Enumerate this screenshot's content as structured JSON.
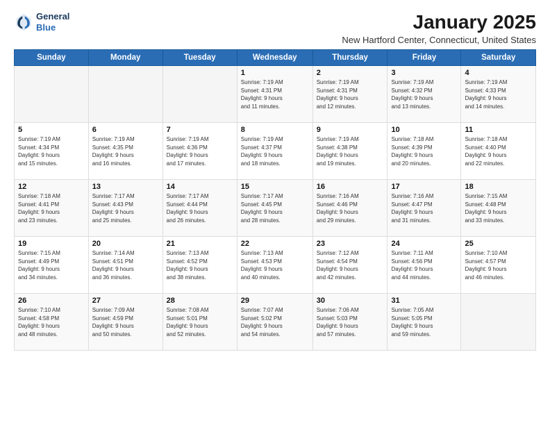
{
  "header": {
    "logo_line1": "General",
    "logo_line2": "Blue",
    "month": "January 2025",
    "location": "New Hartford Center, Connecticut, United States"
  },
  "weekdays": [
    "Sunday",
    "Monday",
    "Tuesday",
    "Wednesday",
    "Thursday",
    "Friday",
    "Saturday"
  ],
  "weeks": [
    [
      {
        "day": "",
        "info": ""
      },
      {
        "day": "",
        "info": ""
      },
      {
        "day": "",
        "info": ""
      },
      {
        "day": "1",
        "info": "Sunrise: 7:19 AM\nSunset: 4:31 PM\nDaylight: 9 hours\nand 11 minutes."
      },
      {
        "day": "2",
        "info": "Sunrise: 7:19 AM\nSunset: 4:31 PM\nDaylight: 9 hours\nand 12 minutes."
      },
      {
        "day": "3",
        "info": "Sunrise: 7:19 AM\nSunset: 4:32 PM\nDaylight: 9 hours\nand 13 minutes."
      },
      {
        "day": "4",
        "info": "Sunrise: 7:19 AM\nSunset: 4:33 PM\nDaylight: 9 hours\nand 14 minutes."
      }
    ],
    [
      {
        "day": "5",
        "info": "Sunrise: 7:19 AM\nSunset: 4:34 PM\nDaylight: 9 hours\nand 15 minutes."
      },
      {
        "day": "6",
        "info": "Sunrise: 7:19 AM\nSunset: 4:35 PM\nDaylight: 9 hours\nand 16 minutes."
      },
      {
        "day": "7",
        "info": "Sunrise: 7:19 AM\nSunset: 4:36 PM\nDaylight: 9 hours\nand 17 minutes."
      },
      {
        "day": "8",
        "info": "Sunrise: 7:19 AM\nSunset: 4:37 PM\nDaylight: 9 hours\nand 18 minutes."
      },
      {
        "day": "9",
        "info": "Sunrise: 7:19 AM\nSunset: 4:38 PM\nDaylight: 9 hours\nand 19 minutes."
      },
      {
        "day": "10",
        "info": "Sunrise: 7:18 AM\nSunset: 4:39 PM\nDaylight: 9 hours\nand 20 minutes."
      },
      {
        "day": "11",
        "info": "Sunrise: 7:18 AM\nSunset: 4:40 PM\nDaylight: 9 hours\nand 22 minutes."
      }
    ],
    [
      {
        "day": "12",
        "info": "Sunrise: 7:18 AM\nSunset: 4:41 PM\nDaylight: 9 hours\nand 23 minutes."
      },
      {
        "day": "13",
        "info": "Sunrise: 7:17 AM\nSunset: 4:43 PM\nDaylight: 9 hours\nand 25 minutes."
      },
      {
        "day": "14",
        "info": "Sunrise: 7:17 AM\nSunset: 4:44 PM\nDaylight: 9 hours\nand 26 minutes."
      },
      {
        "day": "15",
        "info": "Sunrise: 7:17 AM\nSunset: 4:45 PM\nDaylight: 9 hours\nand 28 minutes."
      },
      {
        "day": "16",
        "info": "Sunrise: 7:16 AM\nSunset: 4:46 PM\nDaylight: 9 hours\nand 29 minutes."
      },
      {
        "day": "17",
        "info": "Sunrise: 7:16 AM\nSunset: 4:47 PM\nDaylight: 9 hours\nand 31 minutes."
      },
      {
        "day": "18",
        "info": "Sunrise: 7:15 AM\nSunset: 4:48 PM\nDaylight: 9 hours\nand 33 minutes."
      }
    ],
    [
      {
        "day": "19",
        "info": "Sunrise: 7:15 AM\nSunset: 4:49 PM\nDaylight: 9 hours\nand 34 minutes."
      },
      {
        "day": "20",
        "info": "Sunrise: 7:14 AM\nSunset: 4:51 PM\nDaylight: 9 hours\nand 36 minutes."
      },
      {
        "day": "21",
        "info": "Sunrise: 7:13 AM\nSunset: 4:52 PM\nDaylight: 9 hours\nand 38 minutes."
      },
      {
        "day": "22",
        "info": "Sunrise: 7:13 AM\nSunset: 4:53 PM\nDaylight: 9 hours\nand 40 minutes."
      },
      {
        "day": "23",
        "info": "Sunrise: 7:12 AM\nSunset: 4:54 PM\nDaylight: 9 hours\nand 42 minutes."
      },
      {
        "day": "24",
        "info": "Sunrise: 7:11 AM\nSunset: 4:56 PM\nDaylight: 9 hours\nand 44 minutes."
      },
      {
        "day": "25",
        "info": "Sunrise: 7:10 AM\nSunset: 4:57 PM\nDaylight: 9 hours\nand 46 minutes."
      }
    ],
    [
      {
        "day": "26",
        "info": "Sunrise: 7:10 AM\nSunset: 4:58 PM\nDaylight: 9 hours\nand 48 minutes."
      },
      {
        "day": "27",
        "info": "Sunrise: 7:09 AM\nSunset: 4:59 PM\nDaylight: 9 hours\nand 50 minutes."
      },
      {
        "day": "28",
        "info": "Sunrise: 7:08 AM\nSunset: 5:01 PM\nDaylight: 9 hours\nand 52 minutes."
      },
      {
        "day": "29",
        "info": "Sunrise: 7:07 AM\nSunset: 5:02 PM\nDaylight: 9 hours\nand 54 minutes."
      },
      {
        "day": "30",
        "info": "Sunrise: 7:06 AM\nSunset: 5:03 PM\nDaylight: 9 hours\nand 57 minutes."
      },
      {
        "day": "31",
        "info": "Sunrise: 7:05 AM\nSunset: 5:05 PM\nDaylight: 9 hours\nand 59 minutes."
      },
      {
        "day": "",
        "info": ""
      }
    ]
  ]
}
